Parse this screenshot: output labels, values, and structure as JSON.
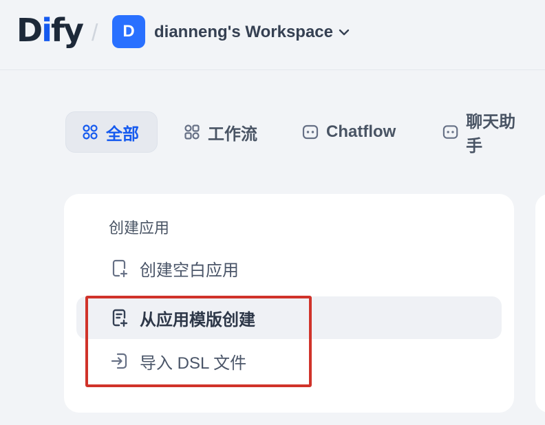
{
  "header": {
    "logo_part1": "D",
    "logo_part2": "i",
    "logo_part3": "fy",
    "separator": "/",
    "workspace_initial": "D",
    "workspace_name": "dianneng's Workspace"
  },
  "tabs": [
    {
      "label": "全部",
      "icon": "grid-icon",
      "active": true
    },
    {
      "label": "工作流",
      "icon": "workflow-icon",
      "active": false
    },
    {
      "label": "Chatflow",
      "icon": "chatflow-icon",
      "active": false
    },
    {
      "label": "聊天助手",
      "icon": "chat-assistant-icon",
      "active": false
    }
  ],
  "create_card": {
    "title": "创建应用",
    "items": [
      {
        "label": "创建空白应用",
        "icon": "file-plus-icon"
      },
      {
        "label": "从应用模版创建",
        "icon": "file-template-icon"
      },
      {
        "label": "导入 DSL 文件",
        "icon": "import-icon"
      }
    ]
  },
  "colors": {
    "accent": "#155aef",
    "avatar": "#2970ff",
    "highlight": "#d0332a",
    "background": "#f2f4f7"
  }
}
